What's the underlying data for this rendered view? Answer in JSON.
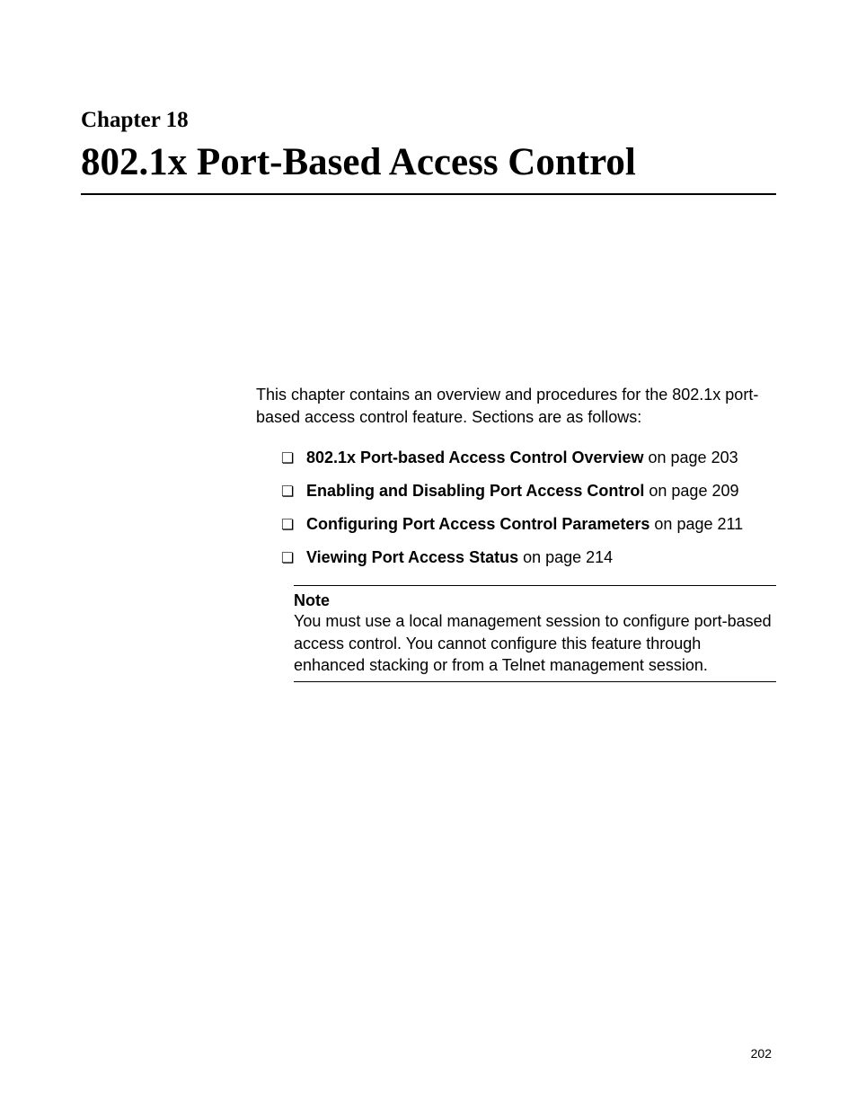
{
  "chapter": {
    "label": "Chapter 18",
    "title": "802.1x Port-Based Access Control"
  },
  "intro": "This chapter contains an overview and procedures for the 802.1x port-based access control feature. Sections are as follows:",
  "sections": [
    {
      "link": "802.1x Port-based Access Control Overview",
      "suffix": " on page 203"
    },
    {
      "link": "Enabling and Disabling Port Access Control",
      "suffix": " on page 209"
    },
    {
      "link": "Configuring Port Access Control Parameters",
      "suffix": " on page 211"
    },
    {
      "link": "Viewing Port Access Status",
      "suffix": " on page 214"
    }
  ],
  "note": {
    "heading": "Note",
    "body": "You must use a local management session to configure port-based access control. You cannot configure this feature through enhanced stacking or from a Telnet management session."
  },
  "page_number": "202"
}
